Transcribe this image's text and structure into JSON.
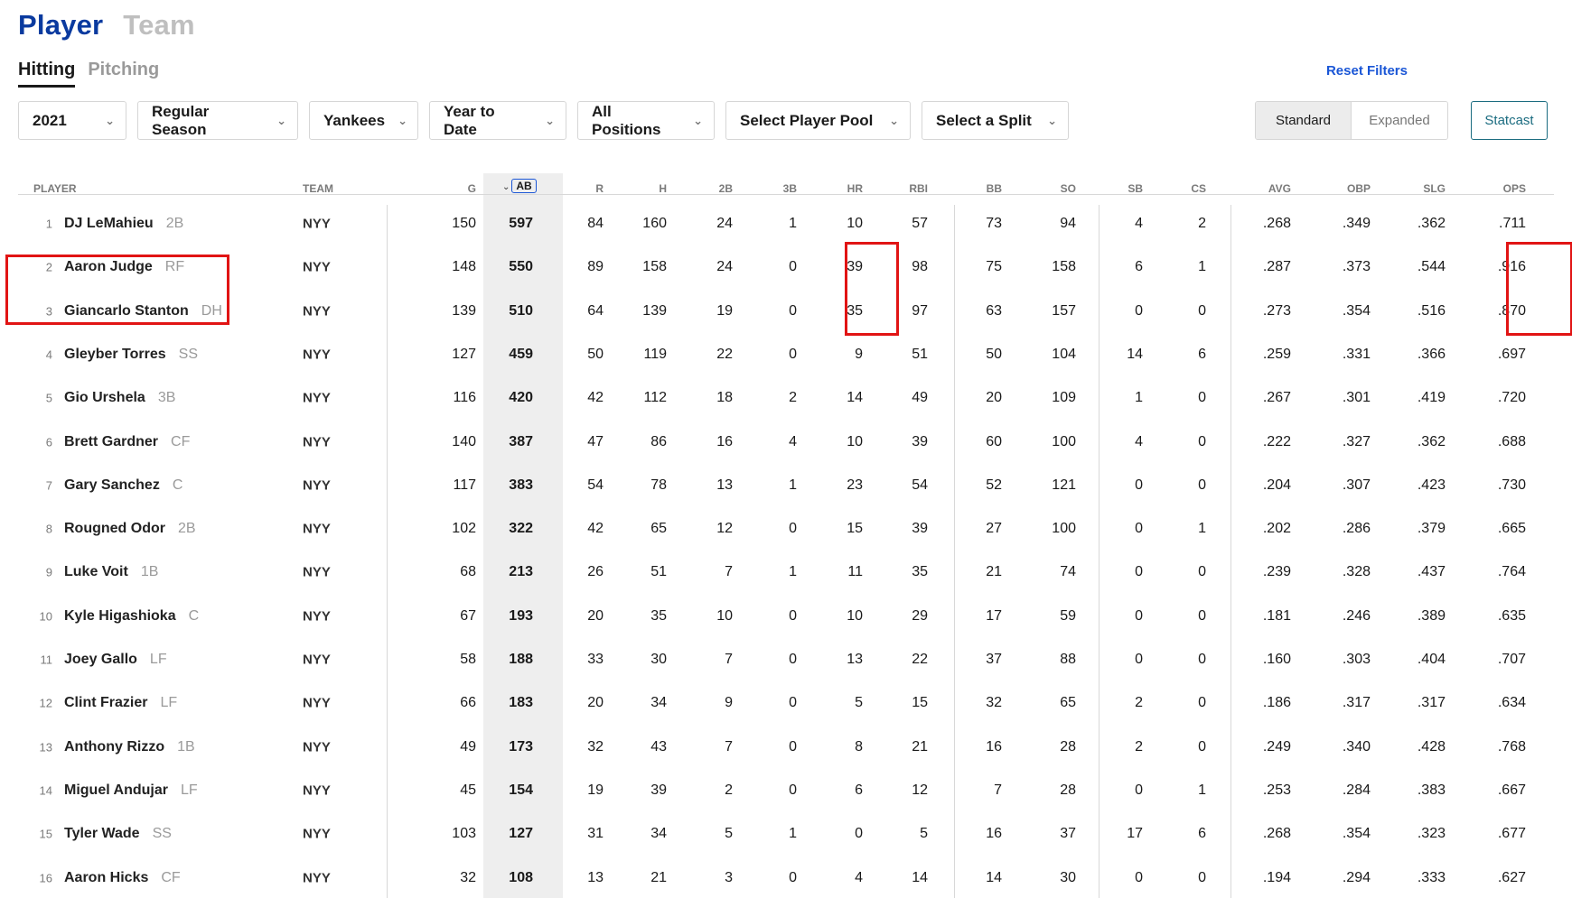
{
  "top_tabs": [
    {
      "label": "Player"
    },
    {
      "label": "Team"
    }
  ],
  "sub_tabs": [
    {
      "label": "Hitting"
    },
    {
      "label": "Pitching"
    }
  ],
  "reset_filters": "Reset Filters",
  "filters": {
    "year": "2021",
    "season": "Regular Season",
    "team": "Yankees",
    "period": "Year to Date",
    "positions": "All Positions",
    "player_pool": "Select Player Pool",
    "split": "Select a Split"
  },
  "view_toggle": {
    "standard": "Standard",
    "expanded": "Expanded"
  },
  "statcast": "Statcast",
  "columns": {
    "player": "PLAYER",
    "team": "TEAM",
    "g": "G",
    "ab": "AB",
    "r": "R",
    "h": "H",
    "2b": "2B",
    "3b": "3B",
    "hr": "HR",
    "rbi": "RBI",
    "bb": "BB",
    "so": "SO",
    "sb": "SB",
    "cs": "CS",
    "avg": "AVG",
    "obp": "OBP",
    "slg": "SLG",
    "ops": "OPS"
  },
  "rows": [
    {
      "rank": "1",
      "name": "DJ LeMahieu",
      "pos": "2B",
      "team": "NYY",
      "g": "150",
      "ab": "597",
      "r": "84",
      "h": "160",
      "d": "24",
      "t": "1",
      "hr": "10",
      "rbi": "57",
      "bb": "73",
      "so": "94",
      "sb": "4",
      "cs": "2",
      "avg": ".268",
      "obp": ".349",
      "slg": ".362",
      "ops": ".711"
    },
    {
      "rank": "2",
      "name": "Aaron Judge",
      "pos": "RF",
      "team": "NYY",
      "g": "148",
      "ab": "550",
      "r": "89",
      "h": "158",
      "d": "24",
      "t": "0",
      "hr": "39",
      "rbi": "98",
      "bb": "75",
      "so": "158",
      "sb": "6",
      "cs": "1",
      "avg": ".287",
      "obp": ".373",
      "slg": ".544",
      "ops": ".916"
    },
    {
      "rank": "3",
      "name": "Giancarlo Stanton",
      "pos": "DH",
      "team": "NYY",
      "g": "139",
      "ab": "510",
      "r": "64",
      "h": "139",
      "d": "19",
      "t": "0",
      "hr": "35",
      "rbi": "97",
      "bb": "63",
      "so": "157",
      "sb": "0",
      "cs": "0",
      "avg": ".273",
      "obp": ".354",
      "slg": ".516",
      "ops": ".870"
    },
    {
      "rank": "4",
      "name": "Gleyber Torres",
      "pos": "SS",
      "team": "NYY",
      "g": "127",
      "ab": "459",
      "r": "50",
      "h": "119",
      "d": "22",
      "t": "0",
      "hr": "9",
      "rbi": "51",
      "bb": "50",
      "so": "104",
      "sb": "14",
      "cs": "6",
      "avg": ".259",
      "obp": ".331",
      "slg": ".366",
      "ops": ".697"
    },
    {
      "rank": "5",
      "name": "Gio Urshela",
      "pos": "3B",
      "team": "NYY",
      "g": "116",
      "ab": "420",
      "r": "42",
      "h": "112",
      "d": "18",
      "t": "2",
      "hr": "14",
      "rbi": "49",
      "bb": "20",
      "so": "109",
      "sb": "1",
      "cs": "0",
      "avg": ".267",
      "obp": ".301",
      "slg": ".419",
      "ops": ".720"
    },
    {
      "rank": "6",
      "name": "Brett Gardner",
      "pos": "CF",
      "team": "NYY",
      "g": "140",
      "ab": "387",
      "r": "47",
      "h": "86",
      "d": "16",
      "t": "4",
      "hr": "10",
      "rbi": "39",
      "bb": "60",
      "so": "100",
      "sb": "4",
      "cs": "0",
      "avg": ".222",
      "obp": ".327",
      "slg": ".362",
      "ops": ".688"
    },
    {
      "rank": "7",
      "name": "Gary Sanchez",
      "pos": "C",
      "team": "NYY",
      "g": "117",
      "ab": "383",
      "r": "54",
      "h": "78",
      "d": "13",
      "t": "1",
      "hr": "23",
      "rbi": "54",
      "bb": "52",
      "so": "121",
      "sb": "0",
      "cs": "0",
      "avg": ".204",
      "obp": ".307",
      "slg": ".423",
      "ops": ".730"
    },
    {
      "rank": "8",
      "name": "Rougned Odor",
      "pos": "2B",
      "team": "NYY",
      "g": "102",
      "ab": "322",
      "r": "42",
      "h": "65",
      "d": "12",
      "t": "0",
      "hr": "15",
      "rbi": "39",
      "bb": "27",
      "so": "100",
      "sb": "0",
      "cs": "1",
      "avg": ".202",
      "obp": ".286",
      "slg": ".379",
      "ops": ".665"
    },
    {
      "rank": "9",
      "name": "Luke Voit",
      "pos": "1B",
      "team": "NYY",
      "g": "68",
      "ab": "213",
      "r": "26",
      "h": "51",
      "d": "7",
      "t": "1",
      "hr": "11",
      "rbi": "35",
      "bb": "21",
      "so": "74",
      "sb": "0",
      "cs": "0",
      "avg": ".239",
      "obp": ".328",
      "slg": ".437",
      "ops": ".764"
    },
    {
      "rank": "10",
      "name": "Kyle Higashioka",
      "pos": "C",
      "team": "NYY",
      "g": "67",
      "ab": "193",
      "r": "20",
      "h": "35",
      "d": "10",
      "t": "0",
      "hr": "10",
      "rbi": "29",
      "bb": "17",
      "so": "59",
      "sb": "0",
      "cs": "0",
      "avg": ".181",
      "obp": ".246",
      "slg": ".389",
      "ops": ".635"
    },
    {
      "rank": "11",
      "name": "Joey Gallo",
      "pos": "LF",
      "team": "NYY",
      "g": "58",
      "ab": "188",
      "r": "33",
      "h": "30",
      "d": "7",
      "t": "0",
      "hr": "13",
      "rbi": "22",
      "bb": "37",
      "so": "88",
      "sb": "0",
      "cs": "0",
      "avg": ".160",
      "obp": ".303",
      "slg": ".404",
      "ops": ".707"
    },
    {
      "rank": "12",
      "name": "Clint Frazier",
      "pos": "LF",
      "team": "NYY",
      "g": "66",
      "ab": "183",
      "r": "20",
      "h": "34",
      "d": "9",
      "t": "0",
      "hr": "5",
      "rbi": "15",
      "bb": "32",
      "so": "65",
      "sb": "2",
      "cs": "0",
      "avg": ".186",
      "obp": ".317",
      "slg": ".317",
      "ops": ".634"
    },
    {
      "rank": "13",
      "name": "Anthony Rizzo",
      "pos": "1B",
      "team": "NYY",
      "g": "49",
      "ab": "173",
      "r": "32",
      "h": "43",
      "d": "7",
      "t": "0",
      "hr": "8",
      "rbi": "21",
      "bb": "16",
      "so": "28",
      "sb": "2",
      "cs": "0",
      "avg": ".249",
      "obp": ".340",
      "slg": ".428",
      "ops": ".768"
    },
    {
      "rank": "14",
      "name": "Miguel Andujar",
      "pos": "LF",
      "team": "NYY",
      "g": "45",
      "ab": "154",
      "r": "19",
      "h": "39",
      "d": "2",
      "t": "0",
      "hr": "6",
      "rbi": "12",
      "bb": "7",
      "so": "28",
      "sb": "0",
      "cs": "1",
      "avg": ".253",
      "obp": ".284",
      "slg": ".383",
      "ops": ".667"
    },
    {
      "rank": "15",
      "name": "Tyler Wade",
      "pos": "SS",
      "team": "NYY",
      "g": "103",
      "ab": "127",
      "r": "31",
      "h": "34",
      "d": "5",
      "t": "1",
      "hr": "0",
      "rbi": "5",
      "bb": "16",
      "so": "37",
      "sb": "17",
      "cs": "6",
      "avg": ".268",
      "obp": ".354",
      "slg": ".323",
      "ops": ".677"
    },
    {
      "rank": "16",
      "name": "Aaron Hicks",
      "pos": "CF",
      "team": "NYY",
      "g": "32",
      "ab": "108",
      "r": "13",
      "h": "21",
      "d": "3",
      "t": "0",
      "hr": "4",
      "rbi": "14",
      "bb": "14",
      "so": "30",
      "sb": "0",
      "cs": "0",
      "avg": ".194",
      "obp": ".294",
      "slg": ".333",
      "ops": ".627"
    }
  ],
  "colors": {
    "brand": "#0a3a9f",
    "link": "#1a56d6",
    "statcast": "#1b6c80",
    "highlight": "#e11414"
  }
}
